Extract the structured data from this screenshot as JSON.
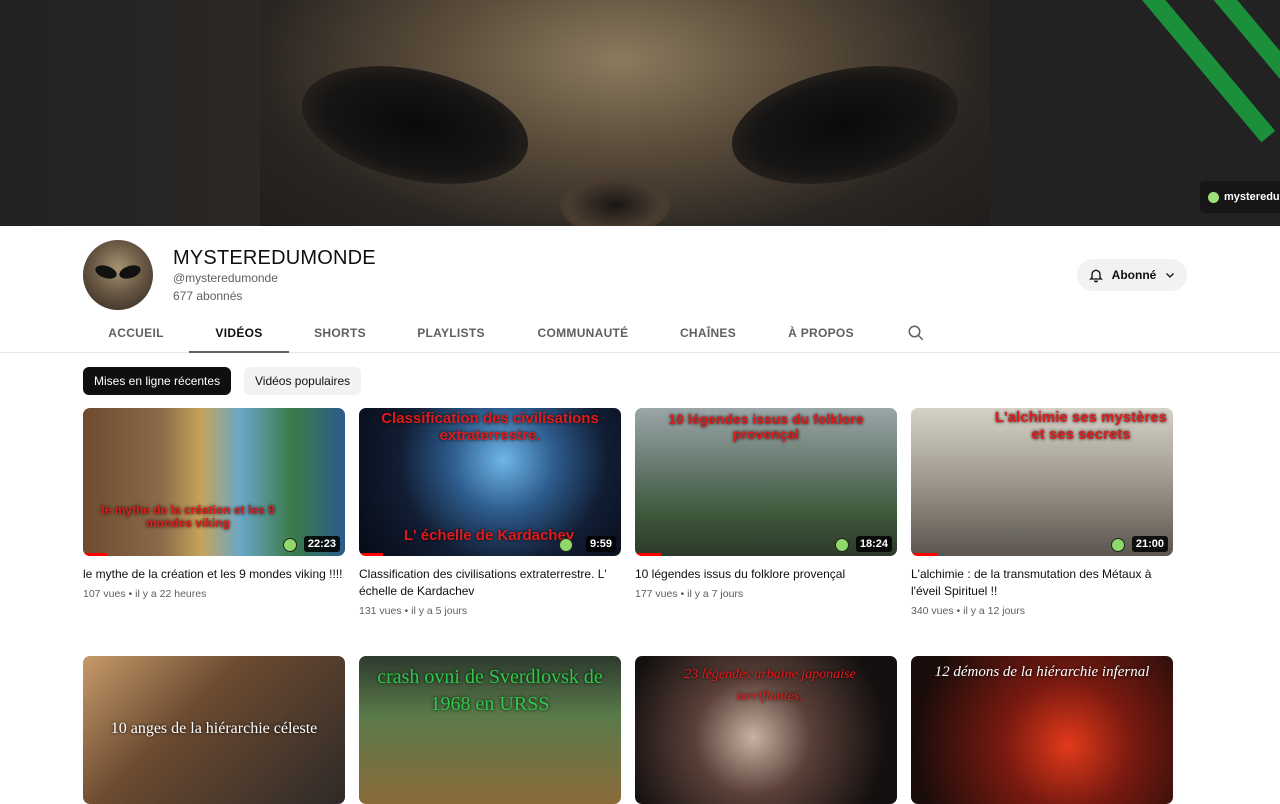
{
  "banner": {
    "watermark": "mysteredumonde",
    "stripe_color": "#1b8f3a"
  },
  "channel": {
    "name": "MYSTEREDUMONDE",
    "handle": "@mysteredumonde",
    "subscribers": "677 abonnés",
    "subscribe_label": "Abonné"
  },
  "tabs": [
    "ACCUEIL",
    "VIDÉOS",
    "SHORTS",
    "PLAYLISTS",
    "COMMUNAUTÉ",
    "CHAÎNES",
    "À PROPOS"
  ],
  "active_tab": "VIDÉOS",
  "chips": [
    "Mises en ligne récentes",
    "Vidéos populaires"
  ],
  "videos": [
    {
      "title": "le mythe de la création et les 9 mondes viking !!!!",
      "views": "107 vues",
      "age": "il y a 22 heures",
      "duration": "22:23",
      "thumb_text": "le mythe de la création et les 9 mondes viking",
      "progress": 0.09
    },
    {
      "title": "Classification des civilisations extraterrestre. L' échelle de Kardachev",
      "views": "131 vues",
      "age": "il y a 5 jours",
      "duration": "9:59",
      "thumb_text": "Classification des civilisations extraterrestre.",
      "thumb_text2": "L' échelle de Kardachev",
      "progress": 0.09
    },
    {
      "title": "10 légendes issus du folklore provençal",
      "views": "177 vues",
      "age": "il y a 7 jours",
      "duration": "18:24",
      "thumb_text": "10 légendes issus du folklore provençal",
      "progress": 0.1
    },
    {
      "title": "L'alchimie : de la transmutation des Métaux à l'éveil Spirituel !!",
      "views": "340 vues",
      "age": "il y a 12 jours",
      "duration": "21:00",
      "thumb_text": "L'alchimie ses mystères et ses secrets",
      "progress": 0.1
    },
    {
      "thumb_text": "10 anges de la hiérarchie céleste"
    },
    {
      "thumb_text": "crash ovni de Sverdlovsk de 1968 en URSS"
    },
    {
      "thumb_text": "23 légendes urbaine japonaise terrifiantes."
    },
    {
      "thumb_text": "12 démons de la hiérarchie infernal"
    }
  ]
}
